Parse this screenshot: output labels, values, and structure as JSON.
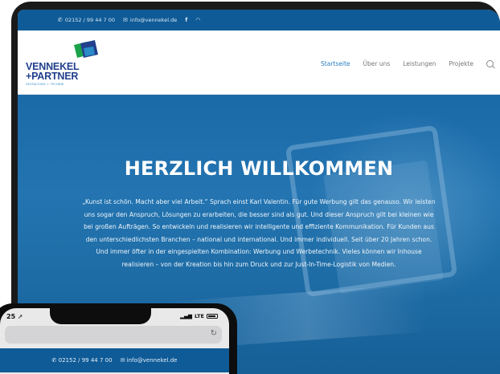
{
  "topbar": {
    "phone": "02152 / 99 44 7 00",
    "email": "info@vennekel.de",
    "icons": [
      "phone-icon",
      "mail-icon",
      "facebook-icon",
      "rss-icon"
    ]
  },
  "logo": {
    "line1": "VENNEKEL",
    "line2": "+PARTNER",
    "tagline": "GESTALTUNG + TECHNIK"
  },
  "nav": {
    "items": [
      {
        "label": "Startseite",
        "active": true
      },
      {
        "label": "Über uns",
        "active": false
      },
      {
        "label": "Leistungen",
        "active": false
      },
      {
        "label": "Projekte",
        "active": false
      }
    ],
    "search_icon": "search-icon"
  },
  "hero": {
    "title": "HERZLICH WILLKOMMEN",
    "text": "„Kunst ist schön. Macht aber viel Arbeit.“ Sprach einst Karl Valentin. Für gute Werbung gilt das genauso. Wir leisten uns sogar den Anspruch, Lösungen zu erarbeiten, die besser sind als gut. Und dieser Anspruch gilt bei kleinen wie bei großen Aufträgen. So entwickeln und realisieren wir intelligente und effiziente Kommunikation. Für Kunden aus den unterschiedlichsten Branchen – national und international. Und immer individuell. Seit über 20 Jahren schon. Und immer öfter in der eingespielten Kombination: Werbung und Werbetechnik. Vieles können wir Inhouse realisieren – von der Kreation bis hin zum Druck und zur Just-In-Time-Logistik von Medien."
  },
  "phone": {
    "time": "25",
    "network": "LTE",
    "topbar_phone": "02152 / 99 44 7 00",
    "topbar_email": "info@vennekel.de"
  },
  "colors": {
    "brand_blue": "#0f5b97",
    "hero_blue": "#2374b1",
    "logo_navy": "#23408e",
    "logo_green": "#1aa34a",
    "nav_active": "#2a7fc3"
  }
}
